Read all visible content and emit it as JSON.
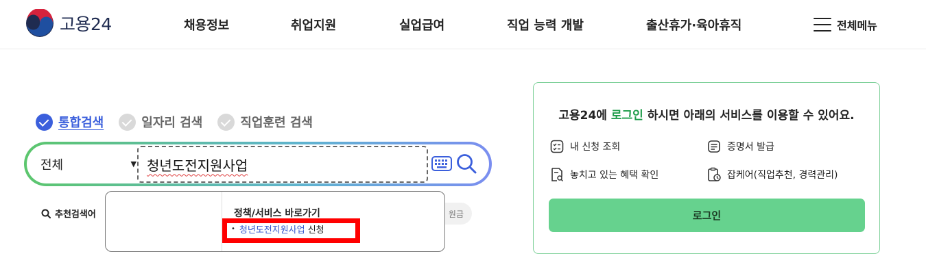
{
  "header": {
    "logo_text": "고용24",
    "nav": [
      "채용정보",
      "취업지원",
      "실업급여",
      "직업 능력 개발",
      "출산휴가·육아휴직"
    ],
    "menu_all_label": "전체메뉴"
  },
  "search": {
    "tabs": [
      {
        "label": "통합검색",
        "active": true
      },
      {
        "label": "일자리 검색",
        "active": false
      },
      {
        "label": "직업훈련 검색",
        "active": false
      }
    ],
    "scope_selected": "전체",
    "query": "청년도전지원사업",
    "recommended_label": "추천검색어",
    "recommended_chip_partial": "원금"
  },
  "autocomplete": {
    "section_title": "정책/서비스 바로가기",
    "item_match": "청년도전지원사업",
    "item_suffix": " 신청"
  },
  "login_panel": {
    "msg_prefix": "고용24에 ",
    "msg_highlight": "로그인",
    "msg_suffix": " 하시면 아래의 서비스를 이용할 수 있어요.",
    "services": [
      "내 신청 조회",
      "증명서 발급",
      "놓치고 있는 혜택 확인",
      "잡케어(직업추천, 경력관리)"
    ],
    "button_label": "로그인"
  },
  "colors": {
    "accent_blue": "#3b5fdc",
    "login_green": "#66d28e",
    "highlight_red": "#ff0000"
  }
}
